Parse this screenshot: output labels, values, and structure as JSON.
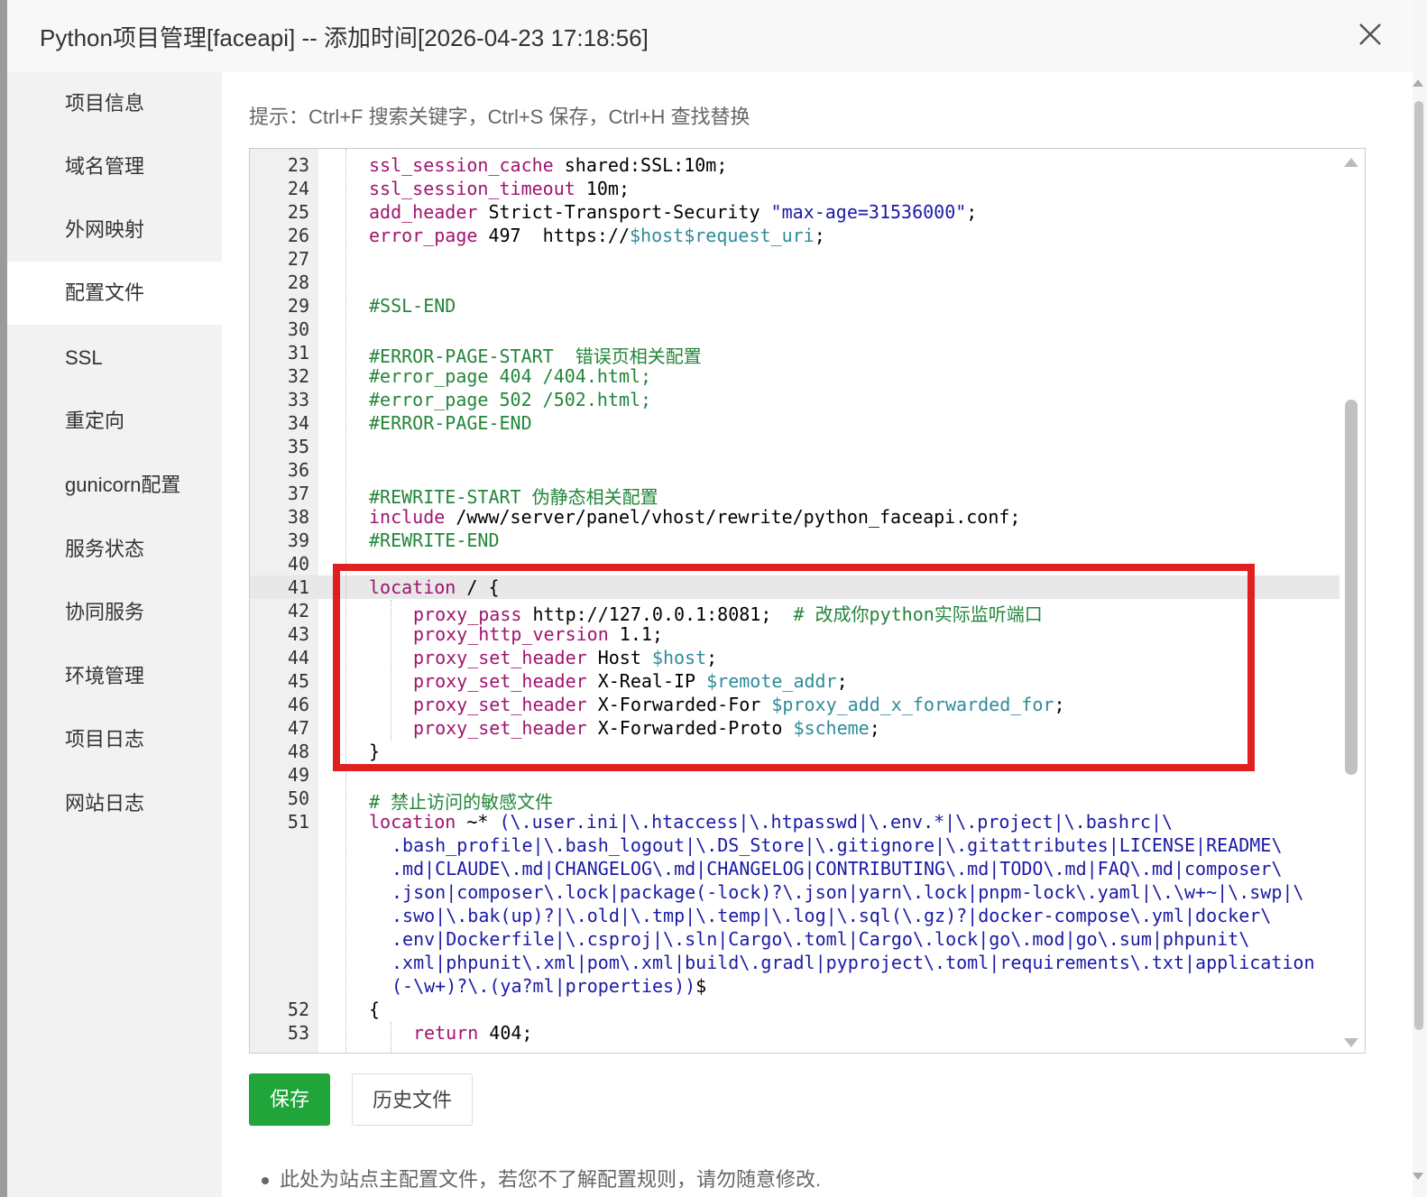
{
  "dialog": {
    "title": "Python项目管理[faceapi] -- 添加时间[2026-04-23 17:18:56]",
    "close_icon": "close-icon"
  },
  "sidebar": {
    "items": [
      {
        "label": "项目信息",
        "active": false
      },
      {
        "label": "域名管理",
        "active": false
      },
      {
        "label": "外网映射",
        "active": false
      },
      {
        "label": "配置文件",
        "active": true
      },
      {
        "label": "SSL",
        "active": false
      },
      {
        "label": "重定向",
        "active": false
      },
      {
        "label": "gunicorn配置",
        "active": false
      },
      {
        "label": "服务状态",
        "active": false
      },
      {
        "label": "协同服务",
        "active": false
      },
      {
        "label": "环境管理",
        "active": false
      },
      {
        "label": "项目日志",
        "active": false
      },
      {
        "label": "网站日志",
        "active": false
      }
    ]
  },
  "main": {
    "hint": "提示：Ctrl+F 搜索关键字，Ctrl+S 保存，Ctrl+H 查找替换",
    "save_label": "保存",
    "history_label": "历史文件",
    "note": "此处为站点主配置文件，若您不了解配置规则，请勿随意修改."
  },
  "editor": {
    "active_line": 41,
    "line_numbers": [
      "23",
      "24",
      "25",
      "26",
      "27",
      "28",
      "29",
      "30",
      "31",
      "32",
      "33",
      "34",
      "35",
      "36",
      "37",
      "38",
      "39",
      "40",
      "41",
      "42",
      "43",
      "44",
      "45",
      "46",
      "47",
      "48",
      "49",
      "50",
      "51",
      "52",
      "53"
    ],
    "lines": {
      "l23": {
        "kw": "ssl_session_cache",
        "rest": " shared:SSL:10m;"
      },
      "l24": {
        "kw": "ssl_session_timeout",
        "rest": " 10m;"
      },
      "l25": {
        "kw": "add_header",
        "rest": " Strict-Transport-Security ",
        "str": "\"max-age=31536000\"",
        "end": ";"
      },
      "l26": {
        "kw": "error_page",
        "rest": " 497  https://",
        "var": "$host$request_uri",
        "end": ";"
      },
      "l29": {
        "cmt": "#SSL-END"
      },
      "l31": {
        "cmt": "#ERROR-PAGE-START  错误页相关配置"
      },
      "l32": {
        "cmt": "#error_page 404 /404.html;"
      },
      "l33": {
        "cmt": "#error_page 502 /502.html;"
      },
      "l34": {
        "cmt": "#ERROR-PAGE-END"
      },
      "l37": {
        "cmt": "#REWRITE-START 伪静态相关配置"
      },
      "l38": {
        "kw": "include",
        "rest": " /www/server/panel/vhost/rewrite/python_faceapi.conf;"
      },
      "l39": {
        "cmt": "#REWRITE-END"
      },
      "l41": {
        "kw": "location",
        "rest": " / {"
      },
      "l42": {
        "kw": "proxy_pass",
        "rest": " http://127.0.0.1:8081;  ",
        "cmt": "# 改成你python实际监听端口"
      },
      "l43": {
        "kw": "proxy_http_version",
        "rest": " 1.1;"
      },
      "l44": {
        "kw": "proxy_set_header",
        "rest": " Host ",
        "var": "$host",
        "end": ";"
      },
      "l45": {
        "kw": "proxy_set_header",
        "rest": " X-Real-IP ",
        "var": "$remote_addr",
        "end": ";"
      },
      "l46": {
        "kw": "proxy_set_header",
        "rest": " X-Forwarded-For ",
        "var": "$proxy_add_x_forwarded_for",
        "end": ";"
      },
      "l47": {
        "kw": "proxy_set_header",
        "rest": " X-Forwarded-Proto ",
        "var": "$scheme",
        "end": ";"
      },
      "l48": {
        "rest": "}"
      },
      "l50": {
        "cmt": "# 禁止访问的敏感文件"
      },
      "l51": {
        "kw": "location",
        "op": " ~* ",
        "wrap": [
          "(\\.user.ini|\\.htaccess|\\.htpasswd|\\.env.*|\\.project|\\.bashrc|\\",
          ".bash_profile|\\.bash_logout|\\.DS_Store|\\.gitignore|\\.gitattributes|LICENSE|README\\",
          ".md|CLAUDE\\.md|CHANGELOG\\.md|CHANGELOG|CONTRIBUTING\\.md|TODO\\.md|FAQ\\.md|composer\\",
          ".json|composer\\.lock|package(-lock)?\\.json|yarn\\.lock|pnpm-lock\\.yaml|\\.\\w+~|\\.swp|\\",
          ".swo|\\.bak(up)?|\\.old|\\.tmp|\\.temp|\\.log|\\.sql(\\.gz)?|docker-compose\\.yml|docker\\",
          ".env|Dockerfile|\\.csproj|\\.sln|Cargo\\.toml|Cargo\\.lock|go\\.mod|go\\.sum|phpunit\\",
          ".xml|phpunit\\.xml|pom\\.xml|build\\.gradl|pyproject\\.toml|requirements\\.txt|application",
          "(-\\w+)?\\.(ya?ml|properties))"
        ],
        "end": "$"
      },
      "l52": {
        "rest": "{"
      },
      "l53": {
        "kw": "return",
        "rest": " 404;"
      }
    }
  },
  "colors": {
    "save_button": "#20a53a",
    "highlight_box": "#e02020",
    "keyword": "#a0146e",
    "comment": "#23863a",
    "variable": "#2e8b9a",
    "string": "#1a1aa6"
  }
}
